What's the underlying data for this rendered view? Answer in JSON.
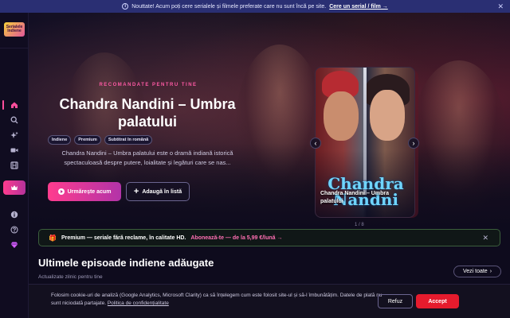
{
  "announcement": {
    "text": "Nouttate! Acum poți cere serialele și filmele preferate care nu sunt încă pe site.",
    "link_label": "Cere un serial / film →"
  },
  "logo": {
    "text": "Serialele Indiene"
  },
  "sidebar": {
    "items": [
      {
        "icon": "home-icon"
      },
      {
        "icon": "search-icon"
      },
      {
        "icon": "sparkles-icon"
      },
      {
        "icon": "video-icon"
      },
      {
        "icon": "film-icon"
      },
      {
        "icon": "crown-icon"
      },
      {
        "icon": "info-icon"
      },
      {
        "icon": "help-icon"
      },
      {
        "icon": "diamond-icon"
      }
    ]
  },
  "hero": {
    "eyebrow": "RECOMANDATE PENTRU TINE",
    "title": "Chandra Nandini – Umbra palatului",
    "tags": [
      "Indiene",
      "Premium",
      "Subtitrat în română"
    ],
    "description": "Chandra Nandini – Umbra palatului este o dramă indiană istorică spectaculoasă despre putere, loialitate și legături care se nas...",
    "watch_label": "Urmărește acum",
    "add_label": "Adaugă în listă"
  },
  "carousel": {
    "poster_caption": "Chandra Nandini – Umbra palatului",
    "poster_art_text": "Chandra Nandni",
    "counter": "1 / 8"
  },
  "premium_banner": {
    "text": "Premium — seriale fără reclame, în calitate HD.",
    "link_label": "Abonează-te — de la 5,99 €/lună →"
  },
  "section": {
    "title": "Ultimele episoade indiene adăugate",
    "subtitle": "Actualizate zilnic pentru tine",
    "see_all_label": "Vezi toate"
  },
  "cookie": {
    "text": "Folosim cookie-uri de analiză (Google Analytics, Microsoft Clarity) ca să înțelegem cum este folosit site-ul și să-l îmbunătățim. Datele de plată nu sunt niciodată partajate.",
    "policy_link": "Politica de confidențialitate",
    "refuse_label": "Refuz",
    "accept_label": "Accept"
  },
  "colors": {
    "accent_pink": "#ff3c8e",
    "accept_red": "#e51b2d",
    "announce_bg": "#2a2f73",
    "premium_green": "#5fd67a"
  }
}
